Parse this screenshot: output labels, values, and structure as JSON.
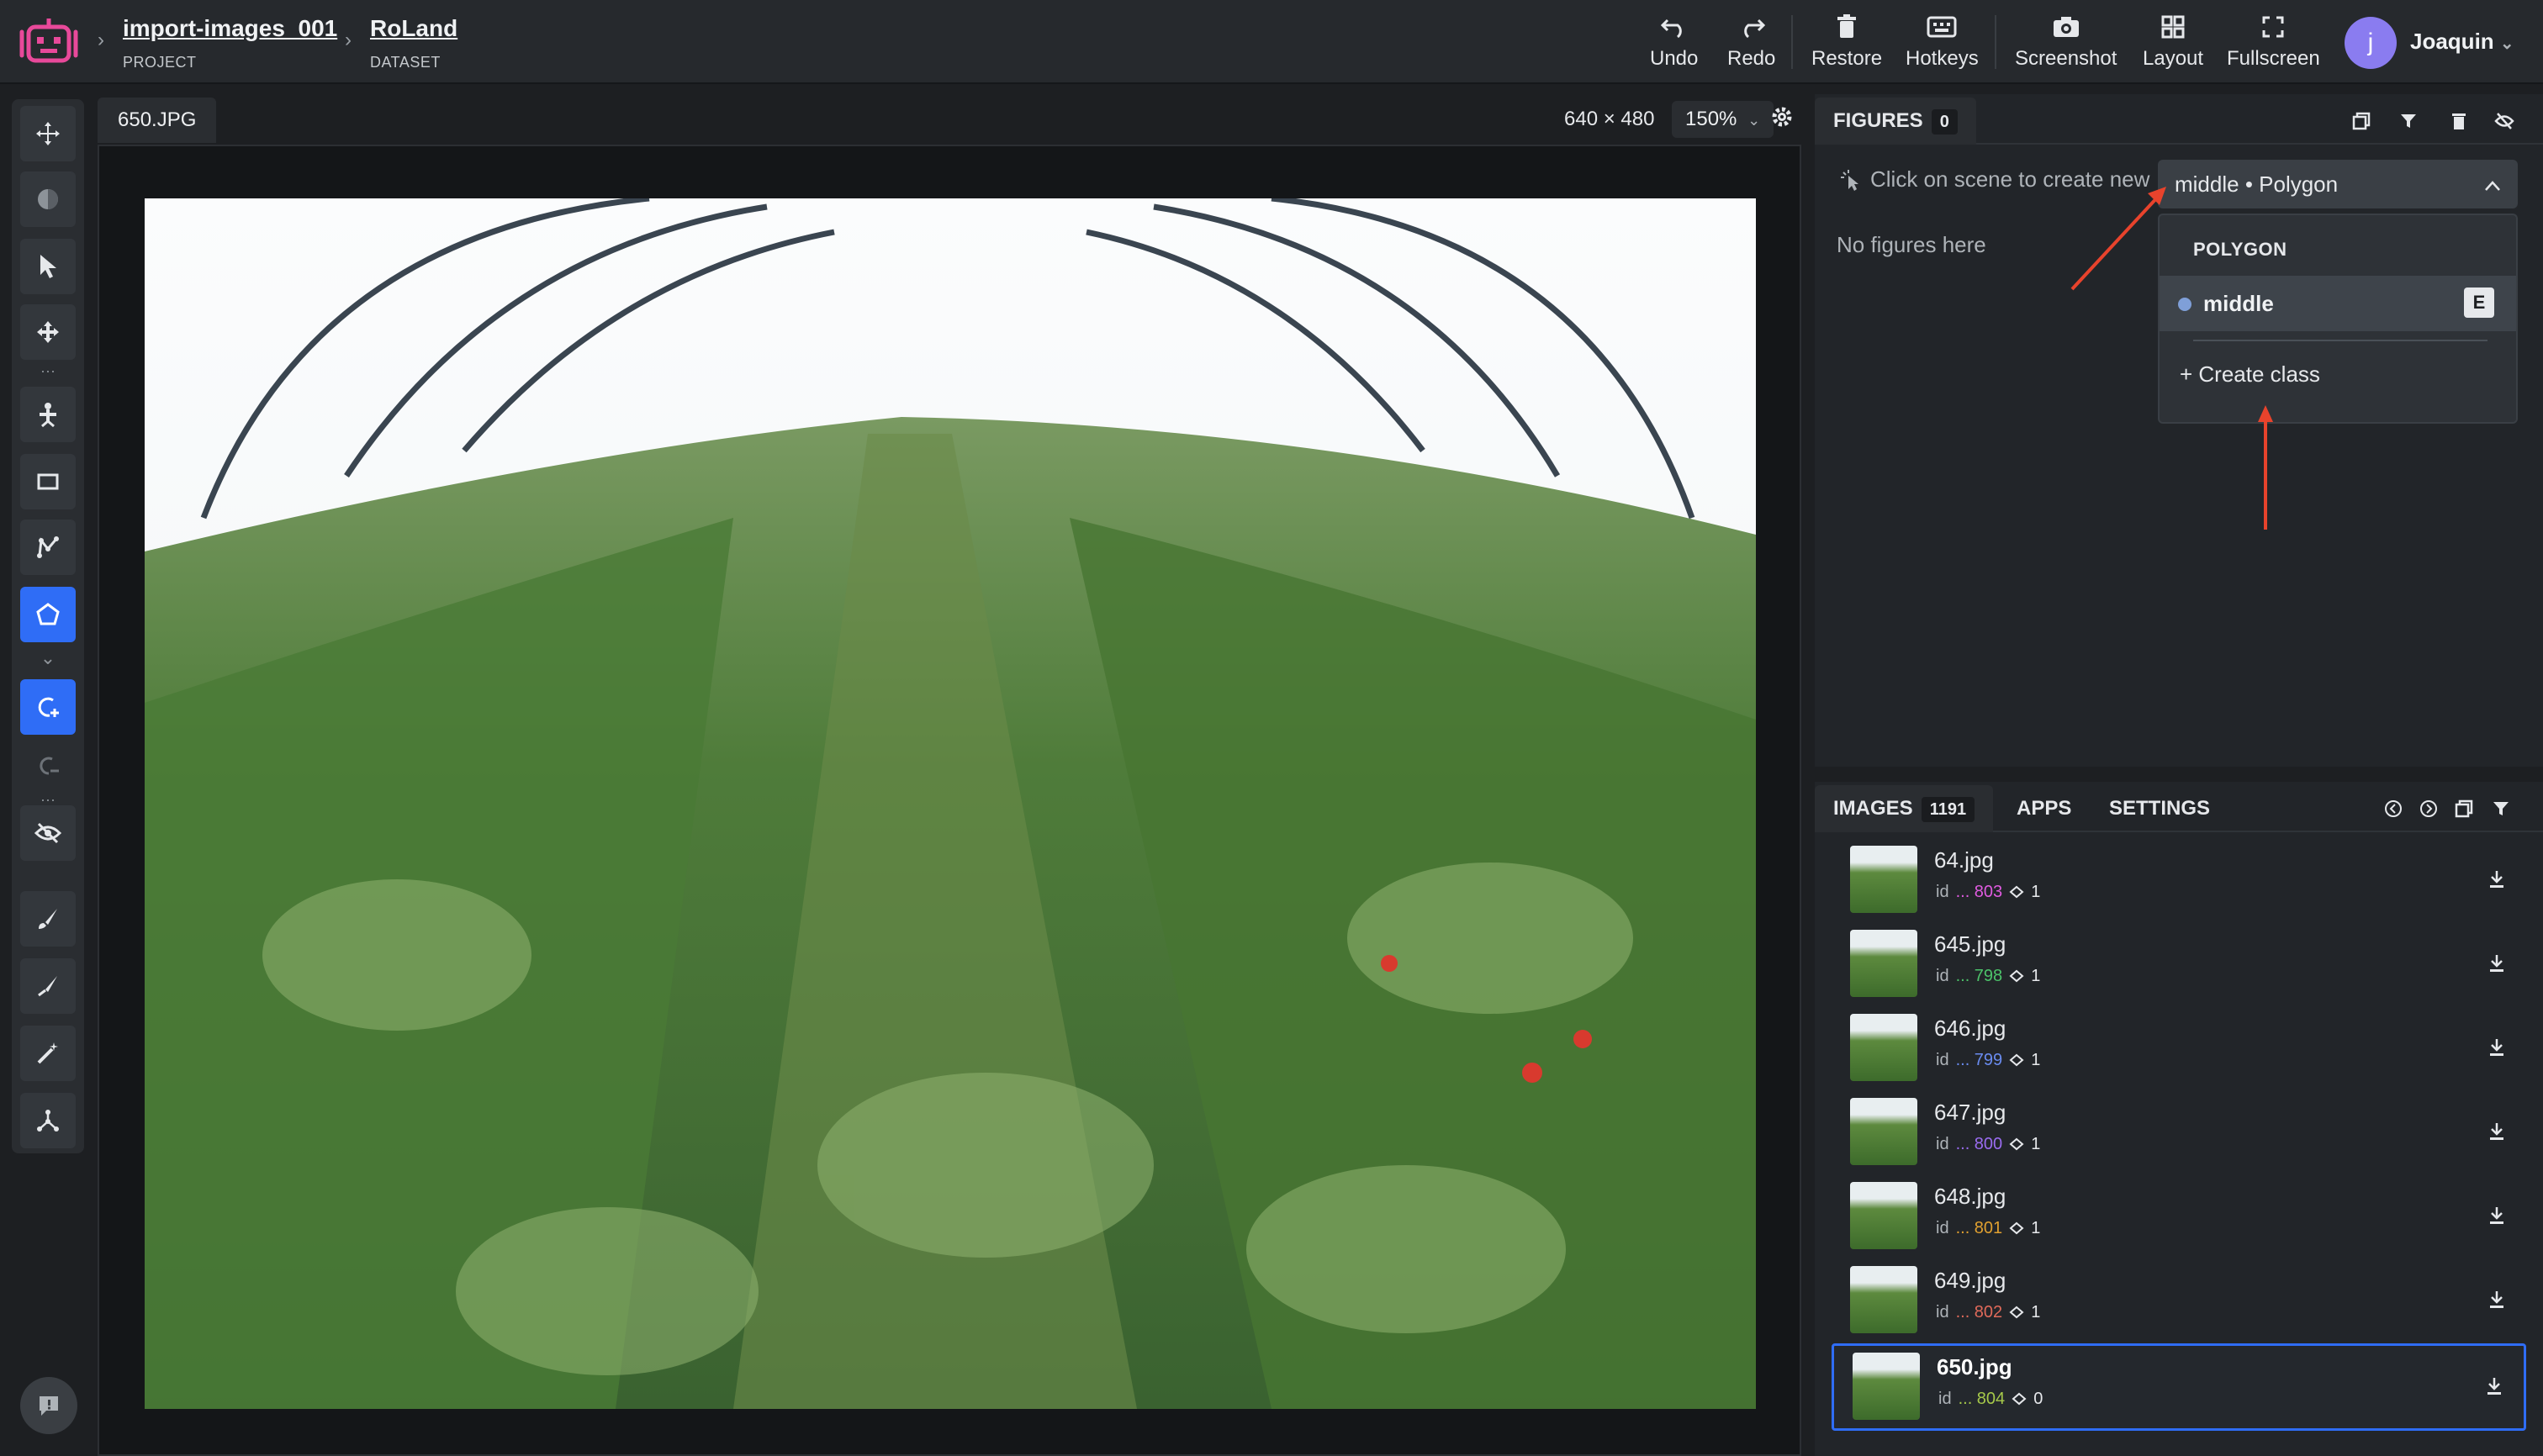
{
  "breadcrumb": [
    {
      "title": "import-images_001",
      "sub": "PROJECT"
    },
    {
      "title": "RoLand",
      "sub": "DATASET"
    }
  ],
  "toolbar": {
    "undo": "Undo",
    "redo": "Redo",
    "restore": "Restore",
    "hotkeys": "Hotkeys",
    "screenshot": "Screenshot",
    "layout": "Layout",
    "fullscreen": "Fullscreen"
  },
  "user": {
    "initial": "j",
    "name": "Joaquin"
  },
  "canvas": {
    "file": "650.JPG",
    "dimensions": "640 × 480",
    "zoom": "150%"
  },
  "figures": {
    "tab_label": "FIGURES",
    "count": "0",
    "hint": "Click on scene to create new",
    "selected_class": "middle • Polygon",
    "empty": "No figures here",
    "dropdown": {
      "group": "POLYGON",
      "item": "middle",
      "hotkey": "E",
      "create": "+ Create class"
    }
  },
  "images_panel": {
    "tabs": [
      {
        "label": "IMAGES",
        "count": "1191"
      },
      {
        "label": "APPS"
      },
      {
        "label": "SETTINGS"
      }
    ],
    "items": [
      {
        "name": "64.jpg",
        "id": "... 803",
        "id_color": "#e05be0",
        "objects": "1"
      },
      {
        "name": "645.jpg",
        "id": "... 798",
        "id_color": "#4cc36a",
        "objects": "1"
      },
      {
        "name": "646.jpg",
        "id": "... 799",
        "id_color": "#6a8cf0",
        "objects": "1"
      },
      {
        "name": "647.jpg",
        "id": "... 800",
        "id_color": "#9a6cf0",
        "objects": "1"
      },
      {
        "name": "648.jpg",
        "id": "... 801",
        "id_color": "#e0a030",
        "objects": "1"
      },
      {
        "name": "649.jpg",
        "id": "... 802",
        "id_color": "#e06a5a",
        "objects": "1"
      },
      {
        "name": "650.jpg",
        "id": "... 804",
        "id_color": "#a6c94a",
        "objects": "0",
        "selected": true
      }
    ]
  },
  "colors": {
    "accent": "#2f6df6",
    "arrow": "#e8432c",
    "brand": "#e8499a"
  }
}
